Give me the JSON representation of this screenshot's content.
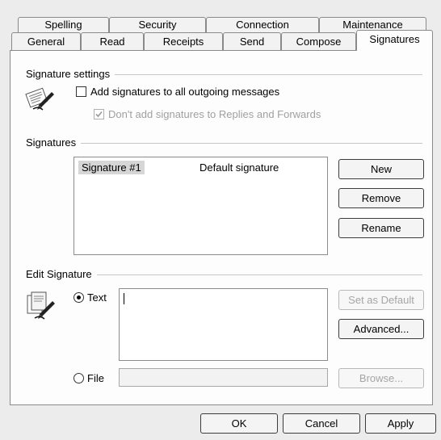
{
  "tabs_row1": [
    "Spelling",
    "Security",
    "Connection",
    "Maintenance"
  ],
  "tabs_row2": [
    "General",
    "Read",
    "Receipts",
    "Send",
    "Compose",
    "Signatures"
  ],
  "signature_settings": {
    "group_label": "Signature settings",
    "add_all_label": "Add signatures to all outgoing messages",
    "add_all_checked": false,
    "no_replies_label": "Don't add signatures to Replies and Forwards",
    "no_replies_checked": true,
    "no_replies_enabled": false
  },
  "signatures": {
    "group_label": "Signatures",
    "list": [
      {
        "name": "Signature #1",
        "status": "Default signature",
        "selected": true
      }
    ],
    "new_label": "New",
    "remove_label": "Remove",
    "rename_label": "Rename"
  },
  "edit_signature": {
    "group_label": "Edit Signature",
    "text_option_label": "Text",
    "text_option_selected": true,
    "text_value": "",
    "file_option_label": "File",
    "file_value": "",
    "set_default_label": "Set as Default",
    "advanced_label": "Advanced...",
    "browse_label": "Browse..."
  },
  "footer": {
    "ok_label": "OK",
    "cancel_label": "Cancel",
    "apply_label": "Apply"
  },
  "icons": {
    "settings_icon": "signature-pen-icon",
    "edit_icon": "edit-signature-pen-icon"
  }
}
